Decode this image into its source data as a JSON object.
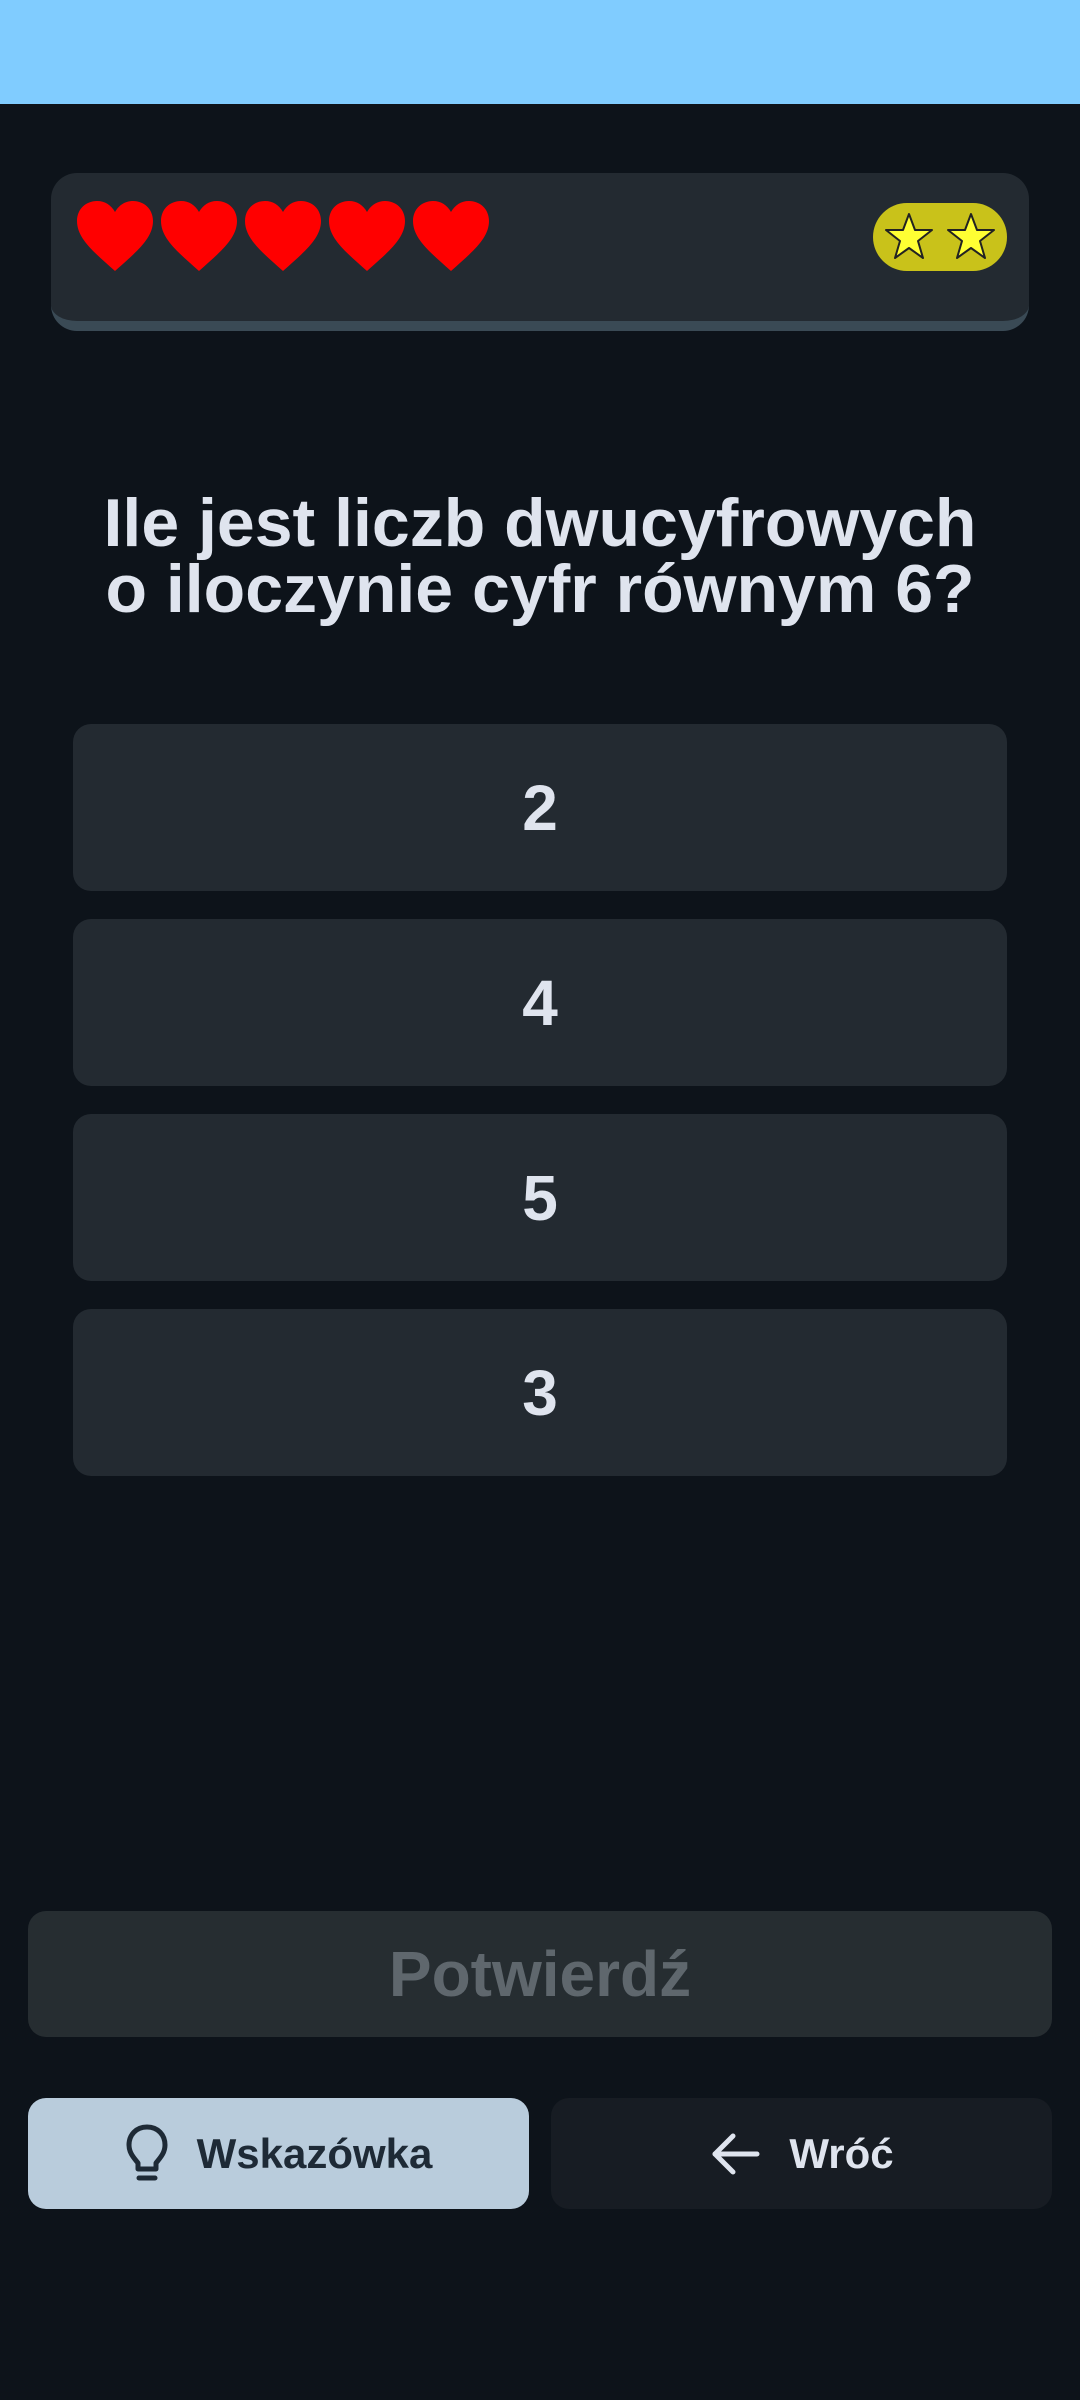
{
  "status": {
    "lives": 5,
    "heart_icon": "heart-icon",
    "heart_color": "#ff0000",
    "stars": 2,
    "star_icon": "star-icon",
    "star_color": "#ffff33",
    "stars_badge_color": "#c9c21a"
  },
  "question": {
    "line1": "Ile jest liczb dwucyfrowych",
    "line2": "o iloczynie cyfr równym 6?"
  },
  "answers": [
    {
      "label": "2"
    },
    {
      "label": "4"
    },
    {
      "label": "5"
    },
    {
      "label": "3"
    }
  ],
  "actions": {
    "confirm_label": "Potwierdź",
    "hint_label": "Wskazówka",
    "hint_icon": "lightbulb-icon",
    "back_label": "Wróć",
    "back_icon": "arrow-left-icon"
  },
  "colors": {
    "background": "#0d131a",
    "status_bar": "#80ccff",
    "card": "#232a31",
    "text": "#dfe4ee",
    "hint_button": "#b9ccdc"
  }
}
